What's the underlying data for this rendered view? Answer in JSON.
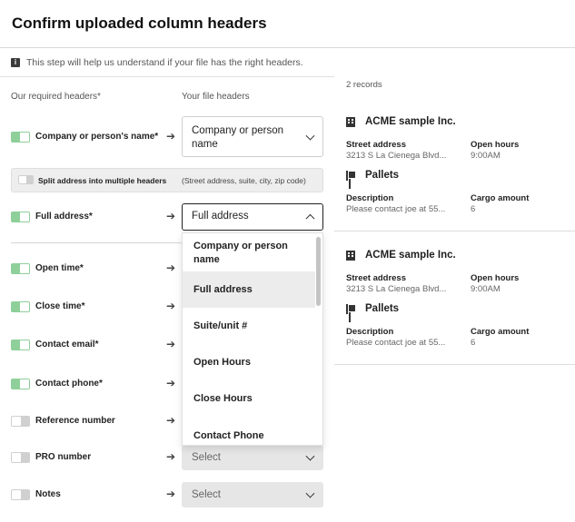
{
  "header": {
    "title": "Confirm uploaded column headers"
  },
  "info": {
    "text": "This step will help us understand if your file has the right headers."
  },
  "columns": {
    "required": "Our required headers*",
    "file": "Your file headers"
  },
  "split": {
    "label": "Split address into multiple headers",
    "hint": "(Street address, suite, city, zip code)"
  },
  "rows": [
    {
      "label": "Company or person's name*",
      "enabled": true,
      "value": "Company or person name"
    },
    {
      "label": "Full address*",
      "enabled": true,
      "value": "Full address"
    },
    {
      "label": "Open time*",
      "enabled": true,
      "value": ""
    },
    {
      "label": "Close time*",
      "enabled": true,
      "value": ""
    },
    {
      "label": "Contact email*",
      "enabled": true,
      "value": ""
    },
    {
      "label": "Contact phone*",
      "enabled": true,
      "value": ""
    },
    {
      "label": "Reference number",
      "enabled": false,
      "value": ""
    },
    {
      "label": "PRO number",
      "enabled": false,
      "value": "Select"
    },
    {
      "label": "Notes",
      "enabled": false,
      "value": "Select"
    }
  ],
  "dropdown": {
    "options": [
      "Company or person name",
      "Full address",
      "Suite/unit #",
      "Open Hours",
      "Close Hours",
      "Contact Phone"
    ],
    "selected": "Full address"
  },
  "records": {
    "count": "2 records",
    "items": [
      {
        "company": "ACME sample Inc.",
        "street_label": "Street address",
        "street_value": "3213 S La Cienega Blvd...",
        "hours_label": "Open hours",
        "hours_value": "9:00AM",
        "cargo_title": "Pallets",
        "desc_label": "Description",
        "desc_value": "Please contact joe at 55...",
        "amount_label": "Cargo amount",
        "amount_value": "6"
      },
      {
        "company": "ACME sample Inc.",
        "street_label": "Street address",
        "street_value": "3213 S La Cienega Blvd...",
        "hours_label": "Open hours",
        "hours_value": "9:00AM",
        "cargo_title": "Pallets",
        "desc_label": "Description",
        "desc_value": "Please contact joe at 55...",
        "amount_label": "Cargo amount",
        "amount_value": "6"
      }
    ]
  },
  "icons": {
    "info": "info-icon",
    "arrow": "arrow-right-icon",
    "chevron": "chevron-down-icon",
    "building": "building-icon",
    "cart": "hand-truck-icon"
  },
  "colors": {
    "toggle_on": "#8fcf9a",
    "toggle_off": "#d0d0d0",
    "selected_option": "#ececec"
  }
}
